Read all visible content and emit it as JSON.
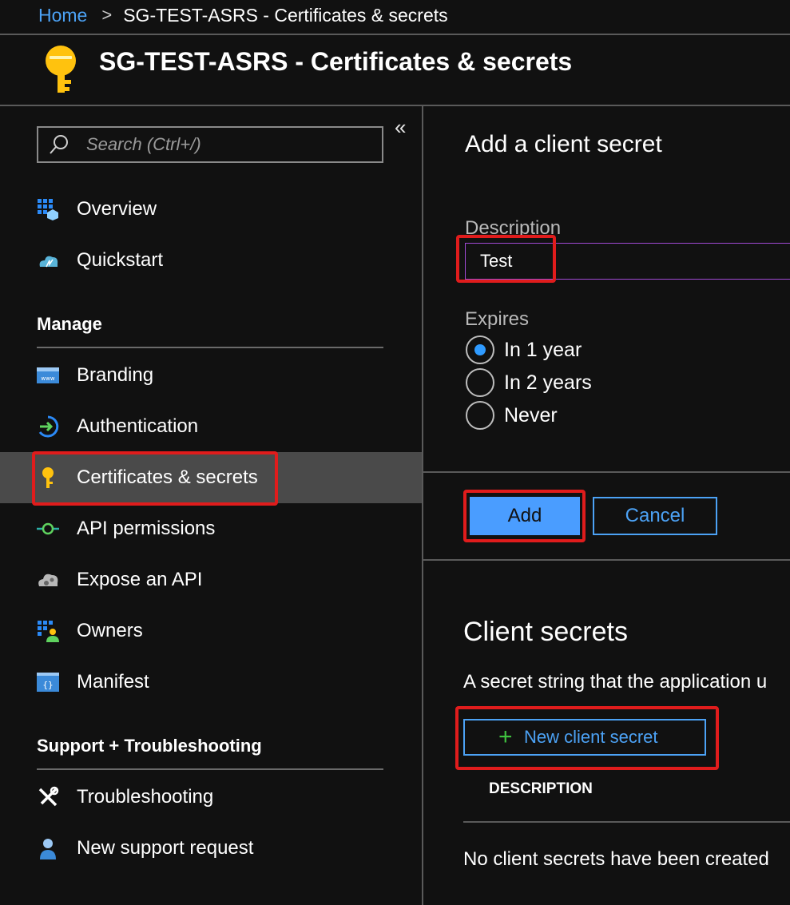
{
  "breadcrumb": {
    "home": "Home",
    "separator": ">",
    "current": "SG-TEST-ASRS - Certificates & secrets"
  },
  "header": {
    "title": "SG-TEST-ASRS - Certificates & secrets",
    "icon": "key-icon"
  },
  "sidebar": {
    "collapse_glyph": "«",
    "search_placeholder": "Search (Ctrl+/)",
    "items": [
      {
        "label": "Overview",
        "icon": "overview-icon"
      },
      {
        "label": "Quickstart",
        "icon": "quickstart-icon"
      }
    ],
    "manage": {
      "heading": "Manage",
      "items": [
        {
          "label": "Branding",
          "icon": "branding-icon"
        },
        {
          "label": "Authentication",
          "icon": "authentication-icon"
        },
        {
          "label": "Certificates & secrets",
          "icon": "key-icon",
          "active": true
        },
        {
          "label": "API permissions",
          "icon": "api-permissions-icon"
        },
        {
          "label": "Expose an API",
          "icon": "expose-api-icon"
        },
        {
          "label": "Owners",
          "icon": "owners-icon"
        },
        {
          "label": "Manifest",
          "icon": "manifest-icon"
        }
      ]
    },
    "support": {
      "heading": "Support + Troubleshooting",
      "items": [
        {
          "label": "Troubleshooting",
          "icon": "wrench-icon"
        },
        {
          "label": "New support request",
          "icon": "support-person-icon"
        }
      ]
    }
  },
  "form": {
    "title": "Add a client secret",
    "description_label": "Description",
    "description_value": "Test",
    "expires_label": "Expires",
    "options": [
      "In 1 year",
      "In 2 years",
      "Never"
    ],
    "selected_option": "In 1 year",
    "add_label": "Add",
    "cancel_label": "Cancel"
  },
  "secrets": {
    "title": "Client secrets",
    "description": "A secret string that the application u",
    "new_button_label": "New client secret",
    "column_header": "DESCRIPTION",
    "empty_message": "No client secrets have been created"
  },
  "colors": {
    "accent": "#4ca2f5",
    "highlight": "#e01c1c",
    "selected_bg": "#4a4a4a",
    "background": "#111111"
  }
}
